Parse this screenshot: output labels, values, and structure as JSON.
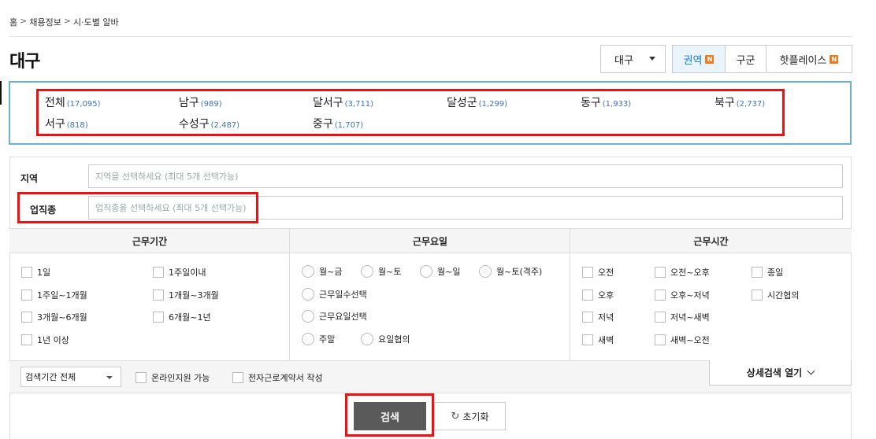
{
  "breadcrumb": {
    "home": "홈",
    "sep": ">",
    "jobs": "채용정보",
    "current": "시·도별 알바"
  },
  "page": {
    "title": "대구"
  },
  "city_select": {
    "value": "대구"
  },
  "tabs": [
    {
      "label": "권역",
      "badge": "N"
    },
    {
      "label": "구군",
      "badge": ""
    },
    {
      "label": "핫플레이스",
      "badge": "N"
    }
  ],
  "districts": [
    {
      "name": "전체",
      "count": "(17,095)"
    },
    {
      "name": "남구",
      "count": "(989)"
    },
    {
      "name": "달서구",
      "count": "(3,711)"
    },
    {
      "name": "달성군",
      "count": "(1,299)"
    },
    {
      "name": "동구",
      "count": "(1,933)"
    },
    {
      "name": "북구",
      "count": "(2,737)"
    },
    {
      "name": "서구",
      "count": "(818)"
    },
    {
      "name": "수성구",
      "count": "(2,487)"
    },
    {
      "name": "중구",
      "count": "(1,707)"
    }
  ],
  "fields": {
    "region": {
      "label": "지역",
      "placeholder": "지역을 선택하세요 (최대 5개 선택가능)"
    },
    "job": {
      "label": "업직종",
      "placeholder": "업직종을 선택하세요 (최대 5개 선택가능)"
    }
  },
  "sections": {
    "period": {
      "title": "근무기간",
      "options": [
        "1일",
        "1주일이내",
        "1주일~1개월",
        "1개월~3개월",
        "3개월~6개월",
        "6개월~1년",
        "1년 이상"
      ]
    },
    "days": {
      "title": "근무요일",
      "options": [
        "월~금",
        "월~토",
        "월~일",
        "월~토(격주)",
        "근무일수선택",
        "근무요일선택",
        "주말",
        "요일협의"
      ]
    },
    "time": {
      "title": "근무시간",
      "options": [
        "오전",
        "오전~오후",
        "종일",
        "오후",
        "오후~저녁",
        "시간협의",
        "저녁",
        "저녁~새벽",
        "새벽",
        "새벽~오전"
      ]
    }
  },
  "bottom": {
    "period_select": "검색기간 전체",
    "online_apply": "온라인지원 가능",
    "e_contract": "전자근로계약서 작성",
    "detail_toggle": "상세검색 열기"
  },
  "actions": {
    "search": "검색",
    "reset": "초기화"
  },
  "colors": {
    "accent": "#1a79d8",
    "badge": "#f27a1a",
    "highlight": "#e11111",
    "district_border": "#6ab1d9"
  }
}
